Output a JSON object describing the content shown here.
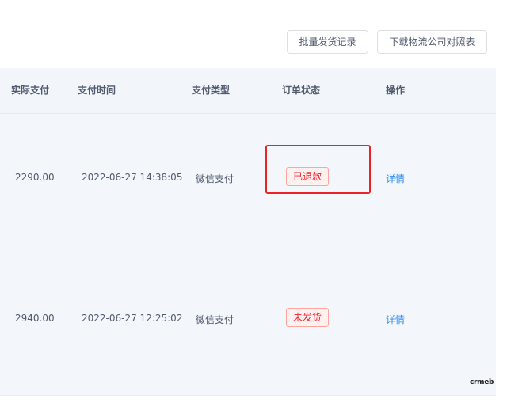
{
  "toolbar": {
    "batch_ship_label": "批量发货记录",
    "download_label": "下载物流公司对照表"
  },
  "table": {
    "columns": [
      "实际支付",
      "支付时间",
      "支付类型",
      "订单状态",
      "操作"
    ],
    "rows": [
      {
        "paid": "2290.00",
        "pay_time": "2022-06-27 14:38:05",
        "pay_type": "微信支付",
        "status": "已退款",
        "action": "详情"
      },
      {
        "paid": "2940.00",
        "pay_time": "2022-06-27 12:25:02",
        "pay_type": "微信支付",
        "status": "未发货",
        "action": "详情"
      }
    ]
  },
  "watermark": "crmeb",
  "colors": {
    "status_red": "#f5222d",
    "link_blue": "#2d8cf0",
    "highlight_red": "#e82323"
  }
}
